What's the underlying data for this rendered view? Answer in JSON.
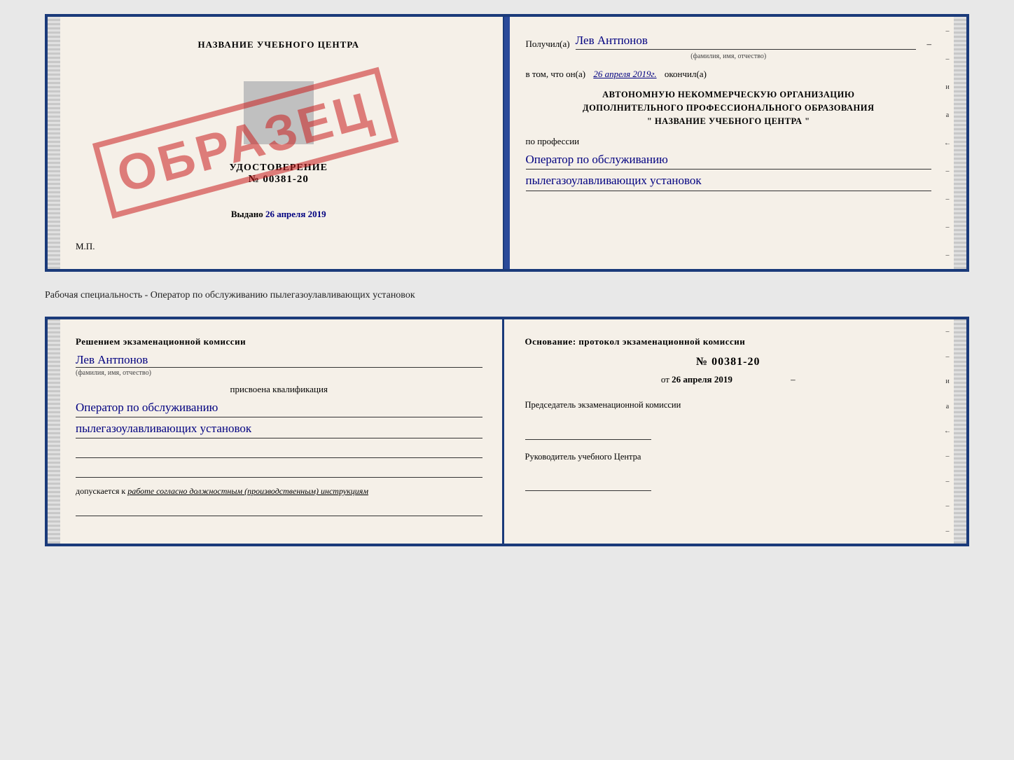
{
  "page": {
    "background_color": "#e8e8e8"
  },
  "top_cert": {
    "left": {
      "school_name": "НАЗВАНИЕ УЧЕБНОГО ЦЕНТРА",
      "cert_label": "УДОСТОВЕРЕНИЕ",
      "cert_number": "№ 00381-20",
      "issued_label": "Выдано",
      "issued_date": "26 апреля 2019",
      "mp_label": "М.П."
    },
    "watermark": "ОБРАЗЕЦ",
    "right": {
      "received_label": "Получил(а)",
      "recipient_name": "Лев Антпонов",
      "fio_hint": "(фамилия, имя, отчество)",
      "date_prefix": "в том, что он(а)",
      "date_value": "26 апреля 2019г.",
      "completed_label": "окончил(а)",
      "org_line1": "АВТОНОМНУЮ НЕКОММЕРЧЕСКУЮ ОРГАНИЗАЦИЮ",
      "org_line2": "ДОПОЛНИТЕЛЬНОГО ПРОФЕССИОНАЛЬНОГО ОБРАЗОВАНИЯ",
      "org_line3": "\"  НАЗВАНИЕ УЧЕБНОГО ЦЕНТРА  \"",
      "profession_label": "по профессии",
      "profession_line1": "Оператор по обслуживанию",
      "profession_line2": "пылегазоулавливающих установок"
    }
  },
  "separator": {
    "text": "Рабочая специальность - Оператор по обслуживанию пылегазоулавливающих установок"
  },
  "bottom_cert": {
    "left": {
      "commission_intro": "Решением экзаменационной комиссии",
      "person_name": "Лев Антпонов",
      "fio_hint": "(фамилия, имя, отчество)",
      "qualification_label": "присвоена квалификация",
      "qualification_line1": "Оператор по обслуживанию",
      "qualification_line2": "пылегазоулавливающих установок",
      "admission_label": "допускается к",
      "admission_value": "работе согласно должностным (производственным) инструкциям"
    },
    "right": {
      "basis_label": "Основание: протокол экзаменационной комиссии",
      "protocol_number": "№  00381-20",
      "date_prefix": "от",
      "date_value": "26 апреля 2019",
      "chairman_label": "Председатель экзаменационной комиссии",
      "director_label": "Руководитель учебного Центра"
    }
  },
  "right_edge": {
    "chars": [
      "–",
      "–",
      "и",
      "а",
      "←",
      "–",
      "–",
      "–",
      "–"
    ]
  }
}
